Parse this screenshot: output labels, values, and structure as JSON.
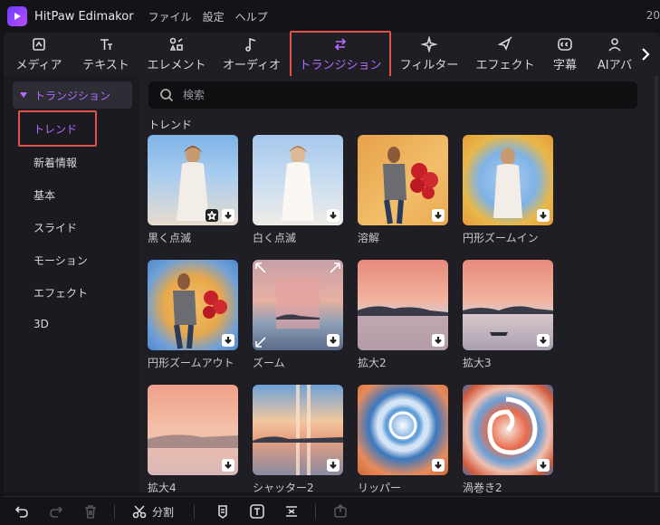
{
  "app": {
    "name": "HitPaw Edimakor",
    "right_text": "20"
  },
  "menu": [
    "ファイル",
    "設定",
    "ヘルプ"
  ],
  "tabs": [
    {
      "label": "メディア",
      "icon": "media-icon"
    },
    {
      "label": "テキスト",
      "icon": "text-icon"
    },
    {
      "label": "エレメント",
      "icon": "element-icon"
    },
    {
      "label": "オーディオ",
      "icon": "audio-icon"
    },
    {
      "label": "トランジション",
      "icon": "transition-icon",
      "active": true
    },
    {
      "label": "フィルター",
      "icon": "filter-icon"
    },
    {
      "label": "エフェクト",
      "icon": "effect-icon"
    },
    {
      "label": "字幕",
      "icon": "subtitle-icon"
    },
    {
      "label": "AIアバ",
      "icon": "ai-avatar-icon"
    }
  ],
  "sidebar": {
    "category": "トランジション",
    "items": [
      "トレンド",
      "新着情報",
      "基本",
      "スライド",
      "モーション",
      "エフェクト",
      "3D"
    ]
  },
  "search": {
    "placeholder": "検索"
  },
  "section_title": "トレンド",
  "cards": [
    {
      "label": "黒く点滅"
    },
    {
      "label": "白く点滅"
    },
    {
      "label": "溶解"
    },
    {
      "label": "円形ズームイン"
    },
    {
      "label": "円形ズームアウト"
    },
    {
      "label": "ズーム"
    },
    {
      "label": "拡大2"
    },
    {
      "label": "拡大3"
    },
    {
      "label": "拡大4"
    },
    {
      "label": "シャッター2"
    },
    {
      "label": "リッパー"
    },
    {
      "label": "渦巻き2"
    }
  ],
  "bottom": {
    "split_label": "分割"
  },
  "colors": {
    "accent": "#b56cff",
    "highlight": "#e0524a"
  }
}
